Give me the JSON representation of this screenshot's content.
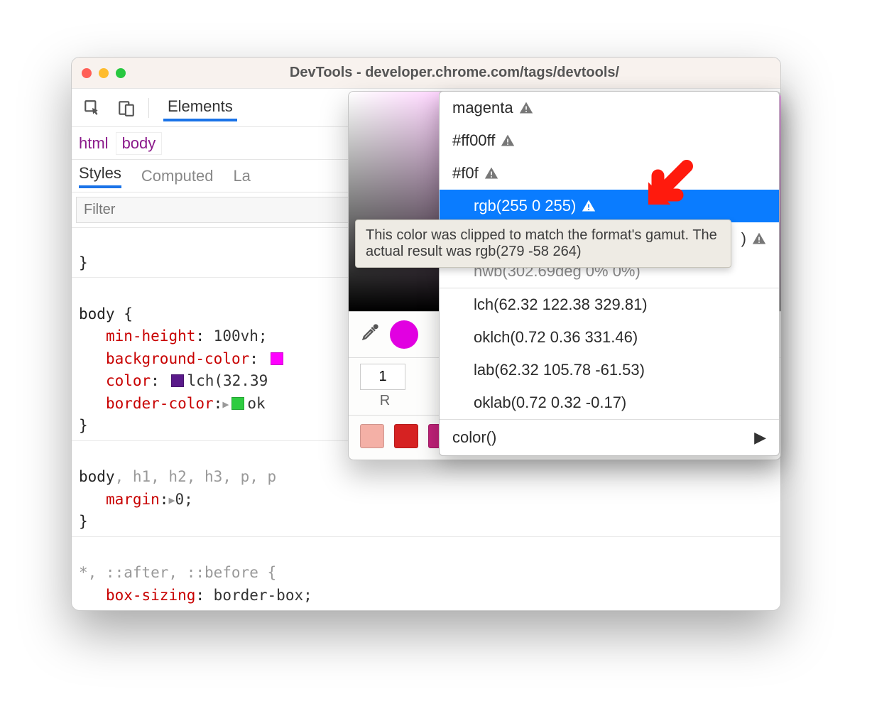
{
  "window": {
    "title": "DevTools - developer.chrome.com/tags/devtools/"
  },
  "toolbar": {
    "tab_elements": "Elements"
  },
  "breadcrumb": {
    "items": [
      "html",
      "body"
    ]
  },
  "subtabs": {
    "styles": "Styles",
    "computed": "Computed",
    "layout_prefix": "La"
  },
  "filter": {
    "placeholder": "Filter"
  },
  "styles": {
    "brace_close_prev": "}",
    "rule1": {
      "selector": "body {",
      "decl1_prop": "min-height",
      "decl1_val": "100vh;",
      "decl2_prop": "background-color",
      "decl2_swatch": "#ff00ff",
      "decl3_prop": "color",
      "decl3_swatch": "#5a1a8a",
      "decl3_val": "lch(32.39 ",
      "decl4_prop": "border-color",
      "decl4_swatch": "#2ecc40",
      "decl4_val": "ok",
      "close": "}"
    },
    "rule2": {
      "selector_main": "body",
      "selector_rest": ", h1, h2, h3, p, p",
      "decl1_prop": "margin",
      "decl1_val": "0;",
      "close": "}"
    },
    "rule3": {
      "selector": "*, ::after, ::before {",
      "decl1_prop": "box-sizing",
      "decl1_val": "border-box;"
    }
  },
  "picker": {
    "alpha_value": "1",
    "r_label": "R"
  },
  "palette": {
    "colors": [
      "#f4b0a6",
      "#d62222",
      "#c2227a",
      "#6b2cc4",
      "#1e3fdd",
      "#1a4ab5",
      "#2f74e6",
      "#2c66c9"
    ]
  },
  "format_menu": {
    "items": [
      {
        "label": "magenta",
        "warn": true
      },
      {
        "label": "#ff00ff",
        "warn": true
      },
      {
        "label": "#f0f",
        "warn": true
      },
      {
        "label": "rgb(255 0 255)",
        "warn": true,
        "selected": true
      },
      {
        "label": ")",
        "warn": true,
        "peek_right": true
      },
      {
        "label": "hwb(302.69deg 0% 0%)",
        "warn": false,
        "dim": true
      }
    ],
    "group2": [
      "lch(62.32 122.38 329.81)",
      "oklch(0.72 0.36 331.46)",
      "lab(62.32 105.78 -61.53)",
      "oklab(0.72 0.32 -0.17)"
    ],
    "color_fn": "color()"
  },
  "tooltip": {
    "text": "This color was clipped to match the format's gamut. The actual result was rgb(279 -58 264)"
  },
  "colors": {
    "accent_blue": "#0a7cff",
    "annotation_red": "#ff1a0d"
  }
}
